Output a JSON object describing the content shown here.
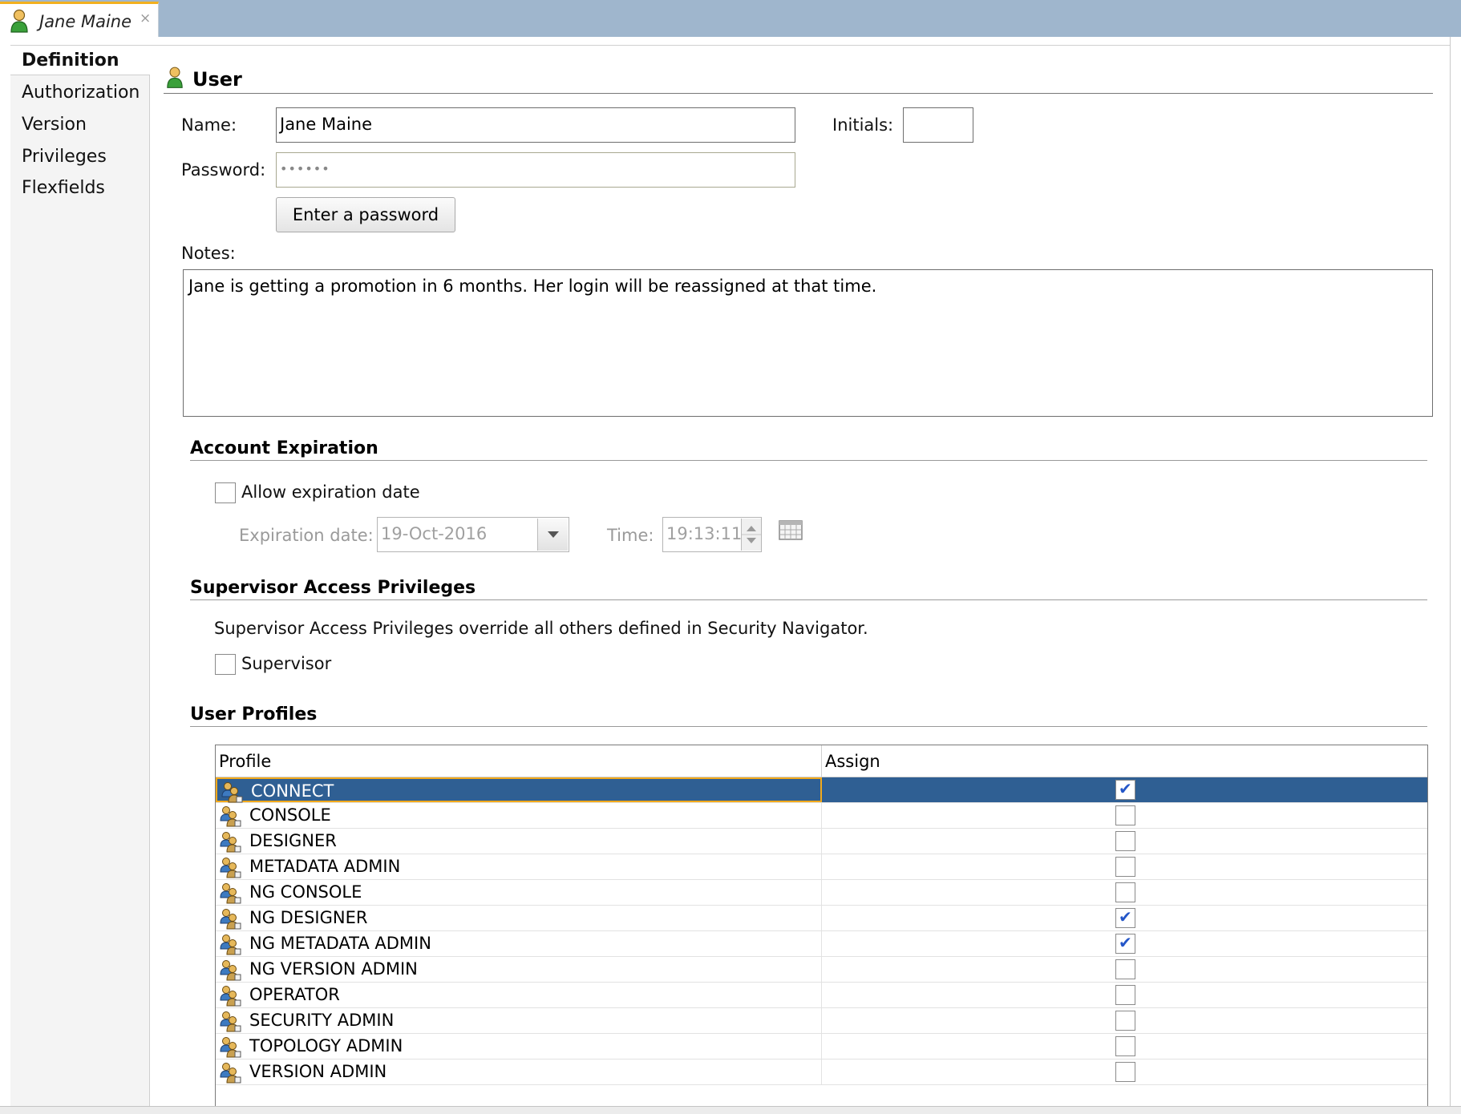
{
  "tab": {
    "title": "Jane Maine",
    "close": "×"
  },
  "nav": {
    "items": [
      {
        "label": "Definition"
      },
      {
        "label": "Authorization"
      },
      {
        "label": "Version"
      },
      {
        "label": "Privileges"
      },
      {
        "label": "Flexfields"
      }
    ]
  },
  "user": {
    "heading": "User",
    "name_label": "Name:",
    "name_value": "Jane Maine",
    "initials_label": "Initials:",
    "initials_value": "",
    "password_label": "Password:",
    "password_value": "••••••",
    "enter_password_button": "Enter a password",
    "notes_label": "Notes:",
    "notes_value": "Jane is getting a promotion in 6 months. Her login will be reassigned at that time."
  },
  "account_expiration": {
    "heading": "Account Expiration",
    "allow_label": "Allow expiration date",
    "allow_checked": false,
    "date_label": "Expiration date:",
    "date_value": "19-Oct-2016",
    "time_label": "Time:",
    "time_value": "19:13:11"
  },
  "supervisor": {
    "heading": "Supervisor Access Privileges",
    "description": "Supervisor Access Privileges override all others defined in Security Navigator.",
    "checkbox_label": "Supervisor",
    "checked": false
  },
  "user_profiles": {
    "heading": "User Profiles",
    "columns": [
      "Profile",
      "Assign"
    ],
    "rows": [
      {
        "profile": "CONNECT",
        "assigned": true,
        "selected": true
      },
      {
        "profile": "CONSOLE",
        "assigned": false
      },
      {
        "profile": "DESIGNER",
        "assigned": false
      },
      {
        "profile": "METADATA ADMIN",
        "assigned": false
      },
      {
        "profile": "NG CONSOLE",
        "assigned": false
      },
      {
        "profile": "NG DESIGNER",
        "assigned": true
      },
      {
        "profile": "NG METADATA ADMIN",
        "assigned": true
      },
      {
        "profile": "NG VERSION ADMIN",
        "assigned": false
      },
      {
        "profile": "OPERATOR",
        "assigned": false
      },
      {
        "profile": "SECURITY ADMIN",
        "assigned": false
      },
      {
        "profile": "TOPOLOGY ADMIN",
        "assigned": false
      },
      {
        "profile": "VERSION ADMIN",
        "assigned": false
      }
    ]
  },
  "icons": {
    "tab": "user-icon",
    "heading": "user-icon",
    "profile_row": "profile-icon",
    "date_dropdown": "chevron-down-icon",
    "time_spinner": "spinner-icon",
    "calendar": "calendar-icon"
  },
  "colors": {
    "tabstrip": "#9fb6cd",
    "tab_accent": "#f2b01e",
    "selected_row": "#2f5f93",
    "selected_outline": "#f2a91b"
  }
}
